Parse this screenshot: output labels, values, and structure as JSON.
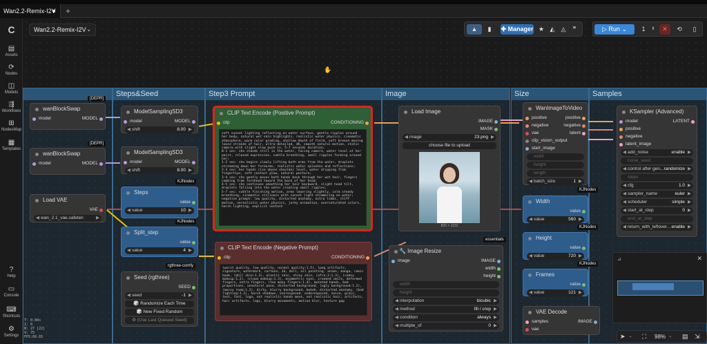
{
  "tab": {
    "title": "Wan2.2-Remix-I2V",
    "plus": "+"
  },
  "workflow_name": "Wan2.2-Remix-I2V",
  "sidebar": [
    {
      "label": "Assets",
      "icon": "▤"
    },
    {
      "label": "Nodes",
      "icon": "⟳"
    },
    {
      "label": "Models",
      "icon": "◫"
    },
    {
      "label": "Workflows",
      "icon": "⇶"
    },
    {
      "label": "NodesMap",
      "icon": "⊞"
    },
    {
      "label": "Templates",
      "icon": "▦"
    },
    {
      "label": "Help",
      "icon": "?"
    },
    {
      "label": "Console",
      "icon": "▭"
    },
    {
      "label": "Shortcuts",
      "icon": "⌨"
    },
    {
      "label": "Settings",
      "icon": "⚙"
    }
  ],
  "toolbar": {
    "manager": "Manager",
    "run": "Run",
    "queue_count": "1"
  },
  "groups": {
    "steps_seed": "Steps&Seed",
    "step3": "Step3 Prompt",
    "image": "Image",
    "size": "Size",
    "samples": "Samples"
  },
  "badges": {
    "depr1": "[DEPR]",
    "depr2": "[DEPR]",
    "kjnodes1": "KJNodes",
    "kjnodes2": "KJNodes",
    "rgthree": "rgthree-comfy",
    "essentials": "essentials",
    "kjnodes3": "KJNodes",
    "kjnodes4": "KJNodes",
    "kjnodes5": "KJNodes"
  },
  "nodes": {
    "wanblock1": {
      "title": "wanBlockSwap",
      "in": "model",
      "out": "MODEL"
    },
    "wanblock2": {
      "title": "wanBlockSwap",
      "in": "model",
      "out": "MODEL"
    },
    "loadvae": {
      "title": "Load VAE",
      "out": "VAE",
      "value": "wan_2.1_vae.safeten"
    },
    "msd1": {
      "title": "ModelSamplingSD3",
      "in": "model",
      "out": "MODEL",
      "wl": "shift",
      "wv": "8.00"
    },
    "msd2": {
      "title": "ModelSamplingSD3",
      "in": "model",
      "out": "MODEL",
      "wl": "shift",
      "wv": "8.00"
    },
    "steps": {
      "title": "Steps",
      "out": "value",
      "wl": "value",
      "wv": "10"
    },
    "split": {
      "title": "Split_step",
      "out": "value",
      "wl": "value",
      "wv": "4"
    },
    "seed": {
      "title": "Seed (rgthree)",
      "out": "SEED",
      "wl": "seed",
      "wv": "-1",
      "b1": "Randomize Each Time",
      "b2": "New Fixed Random",
      "b3": "(Use Last Queued Seed)"
    },
    "clippos": {
      "title": "CLIP Text Encode (Positive Prompt)",
      "in": "clip",
      "out": "CONDITIONING",
      "text": "soft sunset lighting reflecting on water surface, gentle ripples around her body, natural wet skin highlights, realistic water physics, cinematic atmosphere, warm color grading, shallow depth of field, soft breeze moving loose strands of hair, ultra-detailed, 4K, smooth natural motion, static camera with slight slow push-in, 5-7 seconds duration;\n0-1 sec: she stands still in the water, facing camera, water level at her waist, relaxed expression, subtle breathing, small ripples forming around her;\n1-2 sec: she begins slowly lifting both arms from the water, droplets streaming down her forearms, realistic water splashes and reflections;\n2-3 sec: her hands rise above shoulder level, water dripping from fingertips, soft contact glow, natural posture;\n3-4 sec: she gently moves both hands back through her wet hair, fingers combing from forehead toward the back of her head;\n4-5 sec: she continues smoothing her hair backward, slight head tilt, droplets falling into the water creating small ripples;\n5-7 sec: subtle finishing motion, arms lowering slightly, calm steady breathing, cinematic stillness with sunset light shimmering on water;\nnegative prompt: low quality, distorted anatomy, extra limbs, stiff motion, unrealistic water physics, jerky animation, oversaturated colors, harsh lighting, explicit content"
    },
    "clipneg": {
      "title": "CLIP Text Encode (Negative Prompt)",
      "in": "clip",
      "out": "CONDITIONING",
      "text": "(worst quality, low quality, normal quality:1.5), lpeg artifacts, signature, watermark, cartoon, 3d, doll, oil painting, anime, manga, comic book, (doll skin:1.3), plastic skin, shiny skin, (afro:2:1.3), (cakey makeup:1.2), (clown makeup:1.3), asymmetric eyes, crooked smile, deformed fingers, extra fingers, (too many fingers:1.4), mutated hands, bad proportions, unnatural pose, distorted background, (ugly background:1.2), (messy room:1.2), dirty, blurry background, bokeh, distorted anatomy, (bad lighting:1.2), harsh shadows, overexposed, underexposed, noise, grain, text, font, logo, not realistic hands move, not realistic hair, artifacts, hair artifacts, lags, blurry movements, motion blur, texture gap"
    },
    "loadimage": {
      "title": "Load Image",
      "out1": "IMAGE",
      "out2": "MASK",
      "wl": "image",
      "wv": "23.png",
      "btn": "choose file to upload",
      "size": "820 × 1152"
    },
    "resize": {
      "title": "🔧 Image Resize",
      "in": "image",
      "out1": "IMAGE",
      "out2": "width",
      "out3": "height",
      "w1": "width",
      "w2": "height",
      "interp_l": "interpolation",
      "interp_v": "bicubic",
      "method_l": "method",
      "method_v": "fill / crop",
      "cond_l": "condition",
      "cond_v": "always",
      "mult_l": "multiple_of",
      "mult_v": "0"
    },
    "wanimg": {
      "title": "WanImageToVideo",
      "ins": [
        "positive",
        "negative",
        "vae",
        "clip_vision_output",
        "start_image"
      ],
      "outs": [
        "positive",
        "negative",
        "latent"
      ],
      "w1": "width",
      "w2": "height",
      "w3": "length",
      "bl": "batch_size",
      "bv": "1"
    },
    "width": {
      "title": "Width",
      "out": "value",
      "wl": "value",
      "wv": "560"
    },
    "height": {
      "title": "Height",
      "out": "value",
      "wl": "value",
      "wv": "720"
    },
    "frames": {
      "title": "Frames",
      "out": "value",
      "wl": "value",
      "wv": "121"
    },
    "vaedecode": {
      "title": "VAE Decode",
      "ins": [
        "samples",
        "vae"
      ],
      "out": "IMAGE"
    },
    "ksampler": {
      "title": "KSampler (Advanced)",
      "ins": [
        "model",
        "positive",
        "negative",
        "latent_image"
      ],
      "out": "LATENT",
      "widgets": [
        {
          "l": "add_noise",
          "v": "enable"
        },
        {
          "l": "noise_seed",
          "v": ""
        },
        {
          "l": "control after gen...",
          "v": "randomize"
        },
        {
          "l": "steps",
          "v": ""
        },
        {
          "l": "cfg",
          "v": "1.0"
        },
        {
          "l": "sampler_name",
          "v": "euler"
        },
        {
          "l": "scheduler",
          "v": "simple"
        },
        {
          "l": "start_at_step",
          "v": "0"
        },
        {
          "l": "end_at_step",
          "v": ""
        },
        {
          "l": "return_with_leftover...",
          "v": "enable"
        }
      ]
    }
  },
  "stats": [
    "T: 0.00s",
    "I: 0",
    "N: 27 [22]",
    "V: 75",
    "FPS:60.65"
  ],
  "zoom": "98%",
  "colors": {
    "group": "#3b6a90",
    "highlight": "#e0231b",
    "pos_node": "#2f5f35",
    "neg_node": "#5b2e2e",
    "blue_node": "#2e5d8c"
  }
}
